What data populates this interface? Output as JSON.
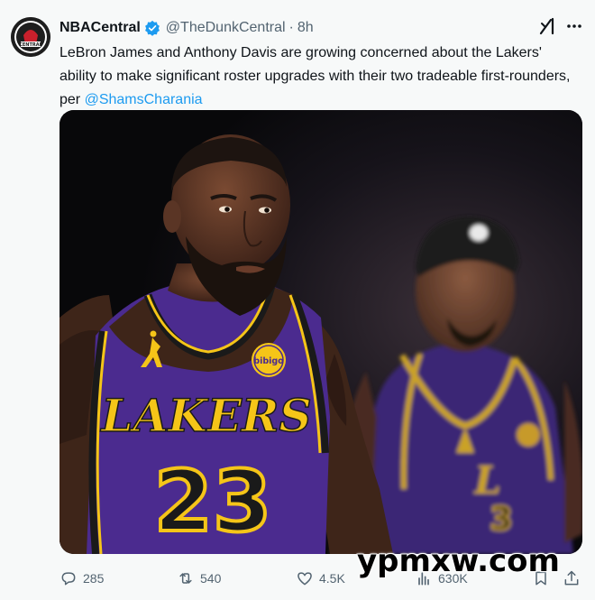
{
  "tweet": {
    "display_name": "NBACentral",
    "handle": "@TheDunkCentral",
    "separator": "·",
    "time": "8h",
    "text_main": "LeBron James and Anthony Davis are growing concerned about the Lakers' ability to make significant roster upgrades with their two tradeable first-rounders, per ",
    "mention": "@ShamsCharania"
  },
  "media": {
    "jersey_wordmark": "LAKERS",
    "jersey_number": "23",
    "patch_text": "bibigo"
  },
  "actions": {
    "replies": "285",
    "reposts": "540",
    "likes": "4.5K",
    "views": "630K"
  },
  "watermark": "ypmxw.com",
  "colors": {
    "accent": "#1d9bf0",
    "text": "#0f1419",
    "muted": "#536471",
    "lakers_purple": "#4b2b8f",
    "lakers_gold": "#f5c518"
  }
}
